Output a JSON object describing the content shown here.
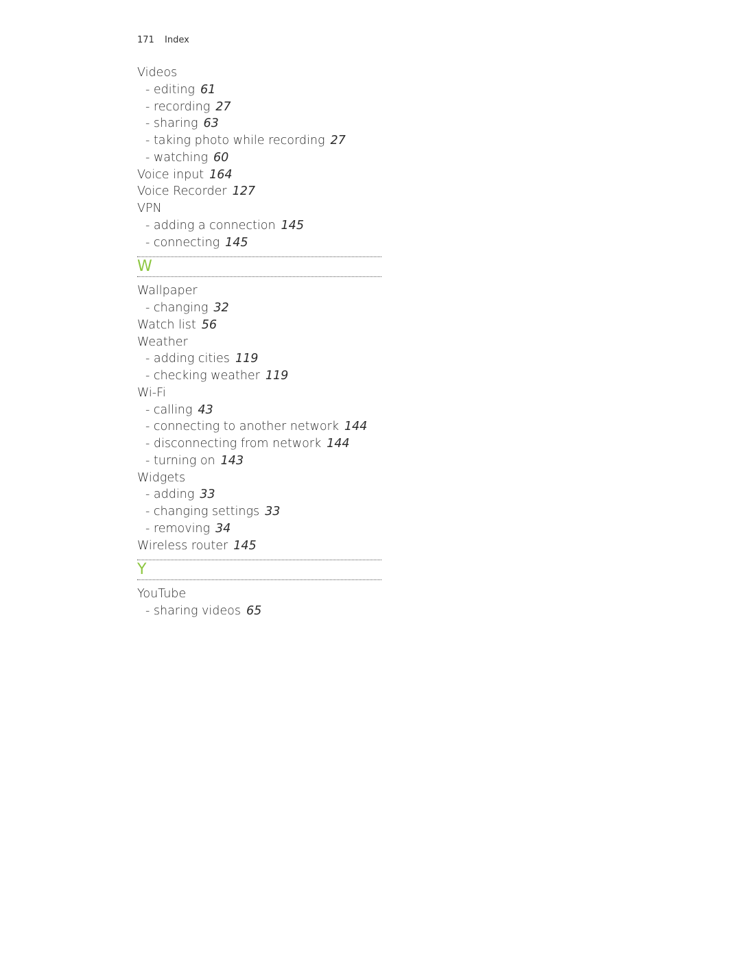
{
  "header": {
    "page_number": "171",
    "section": "Index"
  },
  "groups": [
    {
      "letter": null,
      "entries": [
        {
          "text": "Videos",
          "page": null,
          "sub": false
        },
        {
          "text": "- editing",
          "page": "61",
          "sub": true
        },
        {
          "text": "- recording",
          "page": "27",
          "sub": true
        },
        {
          "text": "- sharing",
          "page": "63",
          "sub": true
        },
        {
          "text": "- taking photo while recording",
          "page": "27",
          "sub": true
        },
        {
          "text": "- watching",
          "page": "60",
          "sub": true
        },
        {
          "text": "Voice input",
          "page": "164",
          "sub": false
        },
        {
          "text": "Voice Recorder",
          "page": "127",
          "sub": false
        },
        {
          "text": "VPN",
          "page": null,
          "sub": false
        },
        {
          "text": "- adding a connection",
          "page": "145",
          "sub": true
        },
        {
          "text": "- connecting",
          "page": "145",
          "sub": true
        }
      ]
    },
    {
      "letter": "W",
      "entries": [
        {
          "text": "Wallpaper",
          "page": null,
          "sub": false
        },
        {
          "text": "- changing",
          "page": "32",
          "sub": true
        },
        {
          "text": "Watch list",
          "page": "56",
          "sub": false
        },
        {
          "text": "Weather",
          "page": null,
          "sub": false
        },
        {
          "text": "- adding cities",
          "page": "119",
          "sub": true
        },
        {
          "text": "- checking weather",
          "page": "119",
          "sub": true
        },
        {
          "text": "Wi-Fi",
          "page": null,
          "sub": false
        },
        {
          "text": "- calling",
          "page": "43",
          "sub": true
        },
        {
          "text": "- connecting to another network",
          "page": "144",
          "sub": true
        },
        {
          "text": "- disconnecting from network",
          "page": "144",
          "sub": true
        },
        {
          "text": "- turning on",
          "page": "143",
          "sub": true
        },
        {
          "text": "Widgets",
          "page": null,
          "sub": false
        },
        {
          "text": "- adding",
          "page": "33",
          "sub": true
        },
        {
          "text": "- changing settings",
          "page": "33",
          "sub": true
        },
        {
          "text": "- removing",
          "page": "34",
          "sub": true
        },
        {
          "text": "Wireless router",
          "page": "145",
          "sub": false
        }
      ]
    },
    {
      "letter": "Y",
      "entries": [
        {
          "text": "YouTube",
          "page": null,
          "sub": false
        },
        {
          "text": "- sharing videos",
          "page": "65",
          "sub": true
        }
      ]
    }
  ],
  "colors": {
    "letter_accent": "#8cc63f",
    "text": "#2b2b2b"
  }
}
